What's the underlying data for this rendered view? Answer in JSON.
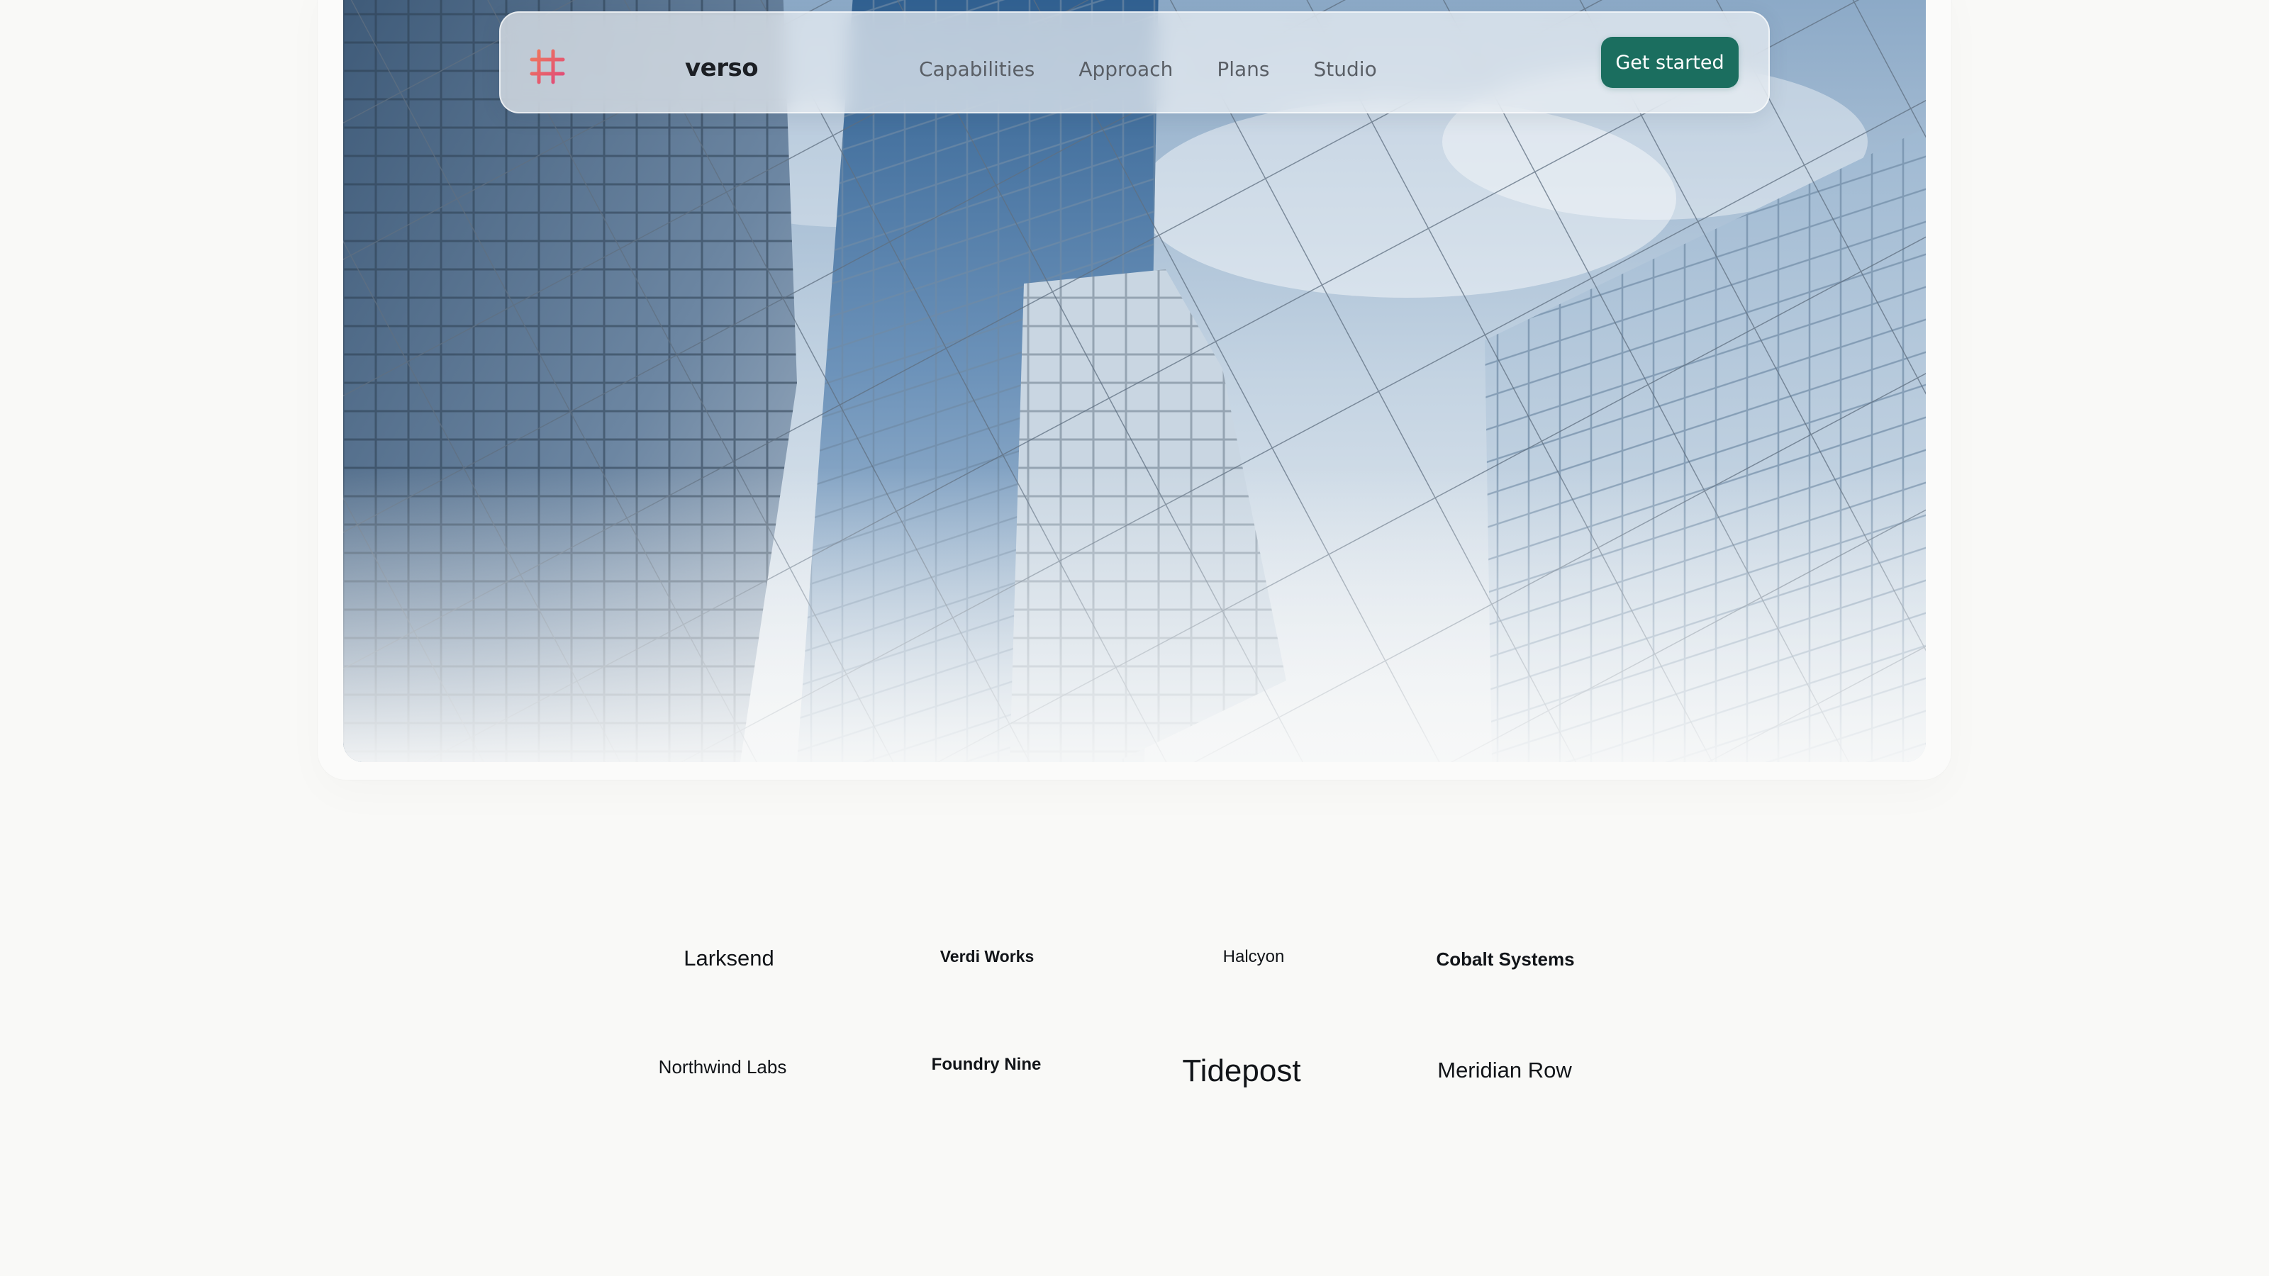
{
  "navbar": {
    "logo_icon": "hashtag-grid-icon",
    "brand": "verso",
    "links": [
      {
        "label": "Capabilities"
      },
      {
        "label": "Approach"
      },
      {
        "label": "Plans"
      },
      {
        "label": "Studio"
      }
    ],
    "cta_label": "Get started",
    "cta_color": "#1b6e5f"
  },
  "hero": {
    "image": "glass-skyscrapers-photo"
  },
  "clients": [
    {
      "name": "Larksend"
    },
    {
      "name": "Verdi Works"
    },
    {
      "name": "Halcyon"
    },
    {
      "name": "Cobalt Systems"
    },
    {
      "name": "Northwind Labs"
    },
    {
      "name": "Foundry Nine"
    },
    {
      "name": "Tidepost"
    },
    {
      "name": "Meridian Row"
    }
  ]
}
